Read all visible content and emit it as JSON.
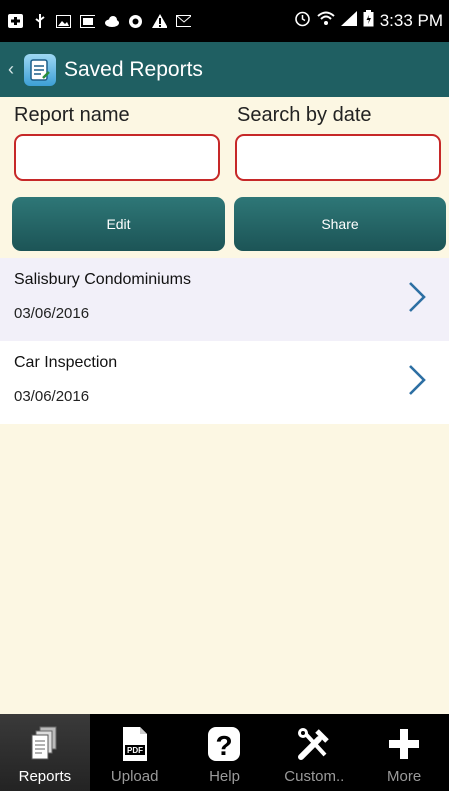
{
  "status_bar": {
    "time": "3:33 PM"
  },
  "app_bar": {
    "title": "Saved Reports",
    "icons": {
      "back": "chevron-left-icon",
      "app": "report-document-icon"
    }
  },
  "search": {
    "report_name_label": "Report name",
    "search_by_date_label": "Search by date",
    "report_name_value": "",
    "search_by_date_value": ""
  },
  "actions": {
    "edit_label": "Edit",
    "share_label": "Share"
  },
  "reports": [
    {
      "name": "Salisbury Condominiums",
      "date": "03/06/2016"
    },
    {
      "name": "Car Inspection",
      "date": "03/06/2016"
    }
  ],
  "bottom_nav": {
    "items": [
      {
        "label": "Reports",
        "icon": "reports-icon",
        "active": true
      },
      {
        "label": "Upload",
        "icon": "pdf-upload-icon",
        "active": false
      },
      {
        "label": "Help",
        "icon": "help-icon",
        "active": false
      },
      {
        "label": "Custom..",
        "icon": "tools-icon",
        "active": false
      },
      {
        "label": "More",
        "icon": "plus-icon",
        "active": false
      }
    ]
  },
  "colors": {
    "header": "#1f5f62",
    "background": "#fcf7e3",
    "input_border": "#c62828",
    "button": "#256a6b",
    "row_alt": "#f2f0f9",
    "chevron": "#2d6fa3"
  }
}
